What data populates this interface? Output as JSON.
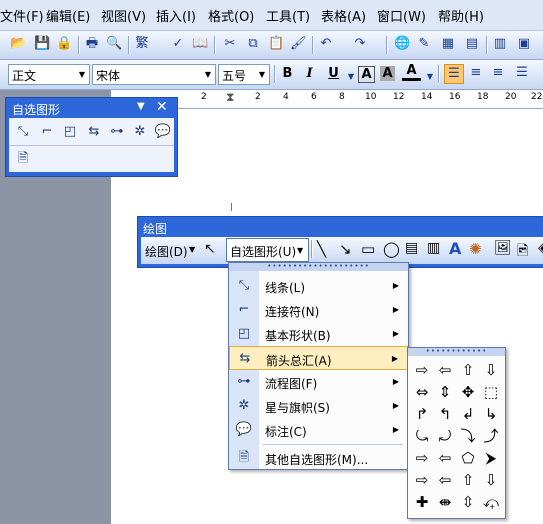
{
  "menubar": {
    "items": [
      "文件(F)",
      "编辑(E)",
      "视图(V)",
      "插入(I)",
      "格式(O)",
      "工具(T)",
      "表格(A)",
      "窗口(W)",
      "帮助(H)"
    ]
  },
  "format_toolbar": {
    "style_value": "正文",
    "font_value": "宋体",
    "size_value": "五号",
    "bold": "B",
    "italic": "I",
    "underline": "U",
    "char_border": "A",
    "char_shading": "A",
    "font_color": "A"
  },
  "ruler": {
    "ticks": [
      "2",
      "2",
      "4",
      "6",
      "8",
      "10",
      "12",
      "14",
      "16",
      "18",
      "20",
      "22"
    ]
  },
  "autoshapes_window": {
    "title": "自选图形",
    "icons": [
      "lines-icon",
      "connectors-icon",
      "basic-shapes-icon",
      "block-arrows-icon",
      "flowchart-icon",
      "stars-banners-icon",
      "callouts-icon",
      "more-autoshapes-icon"
    ]
  },
  "drawing_toolbar": {
    "title": "绘图",
    "draw_label": "绘图(D)",
    "autoshapes_label": "自选图形(U)"
  },
  "autoshape_menu": {
    "items": [
      {
        "label": "线条(L)",
        "icon": "lines-icon",
        "submenu": true
      },
      {
        "label": "连接符(N)",
        "icon": "connectors-icon",
        "submenu": true
      },
      {
        "label": "基本形状(B)",
        "icon": "basic-shapes-icon",
        "submenu": true
      },
      {
        "label": "箭头总汇(A)",
        "icon": "block-arrows-icon",
        "submenu": true,
        "highlighted": true
      },
      {
        "label": "流程图(F)",
        "icon": "flowchart-icon",
        "submenu": true
      },
      {
        "label": "星与旗帜(S)",
        "icon": "stars-banners-icon",
        "submenu": true
      },
      {
        "label": "标注(C)",
        "icon": "callouts-icon",
        "submenu": true
      },
      {
        "label": "其他自选图形(M)...",
        "icon": "more-autoshapes-icon",
        "submenu": false
      }
    ]
  },
  "arrows_menu": {
    "glyphs": [
      "⇨",
      "⇦",
      "⇧",
      "⇩",
      "⇔",
      "⇕",
      "✥",
      "⬚",
      "↱",
      "↰",
      "↲",
      "↳",
      "⤿",
      "⤾",
      "⤵",
      "⤴",
      "⇨",
      "⇦",
      "⬠",
      "⮞",
      "⇨",
      "⇦",
      "⇧",
      "⇩",
      "✚",
      "⇼",
      "⇳",
      "⤽"
    ]
  }
}
